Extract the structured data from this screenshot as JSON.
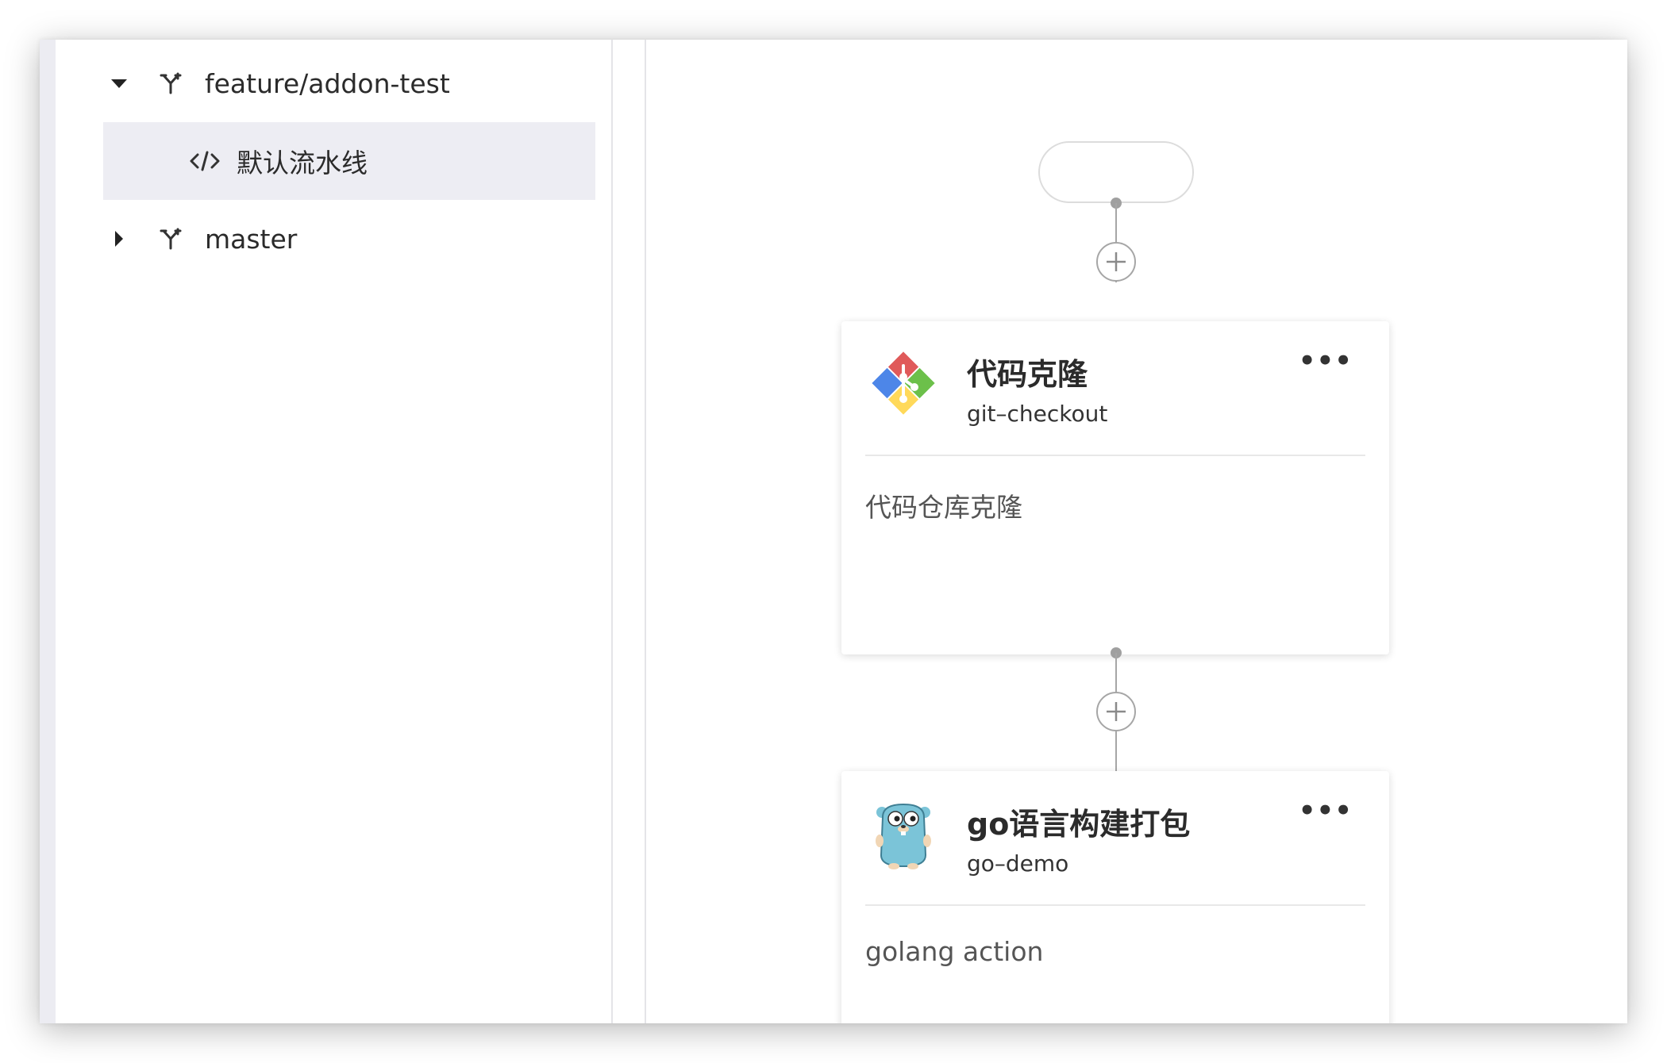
{
  "tree": {
    "branches": [
      {
        "name": "feature/addon-test",
        "expanded": true,
        "icon": "branch-icon",
        "pipelines": [
          {
            "name": "默认流水线",
            "icon": "code-icon",
            "selected": true
          }
        ]
      },
      {
        "name": "master",
        "expanded": false,
        "icon": "branch-icon"
      }
    ]
  },
  "pipeline": {
    "nodes": [
      {
        "title": "代码克隆",
        "subtitle": "git–checkout",
        "description": "代码仓库克隆",
        "more": "•••",
        "icon": "git-logo-icon"
      },
      {
        "title": "go语言构建打包",
        "subtitle": "go–demo",
        "description": "golang action",
        "more": "•••",
        "icon": "go-gopher-icon"
      }
    ]
  },
  "colors": {
    "selected_row_bg": "#ededf3",
    "connector": "#a6a6a6",
    "left_strip": "#ececf2"
  }
}
